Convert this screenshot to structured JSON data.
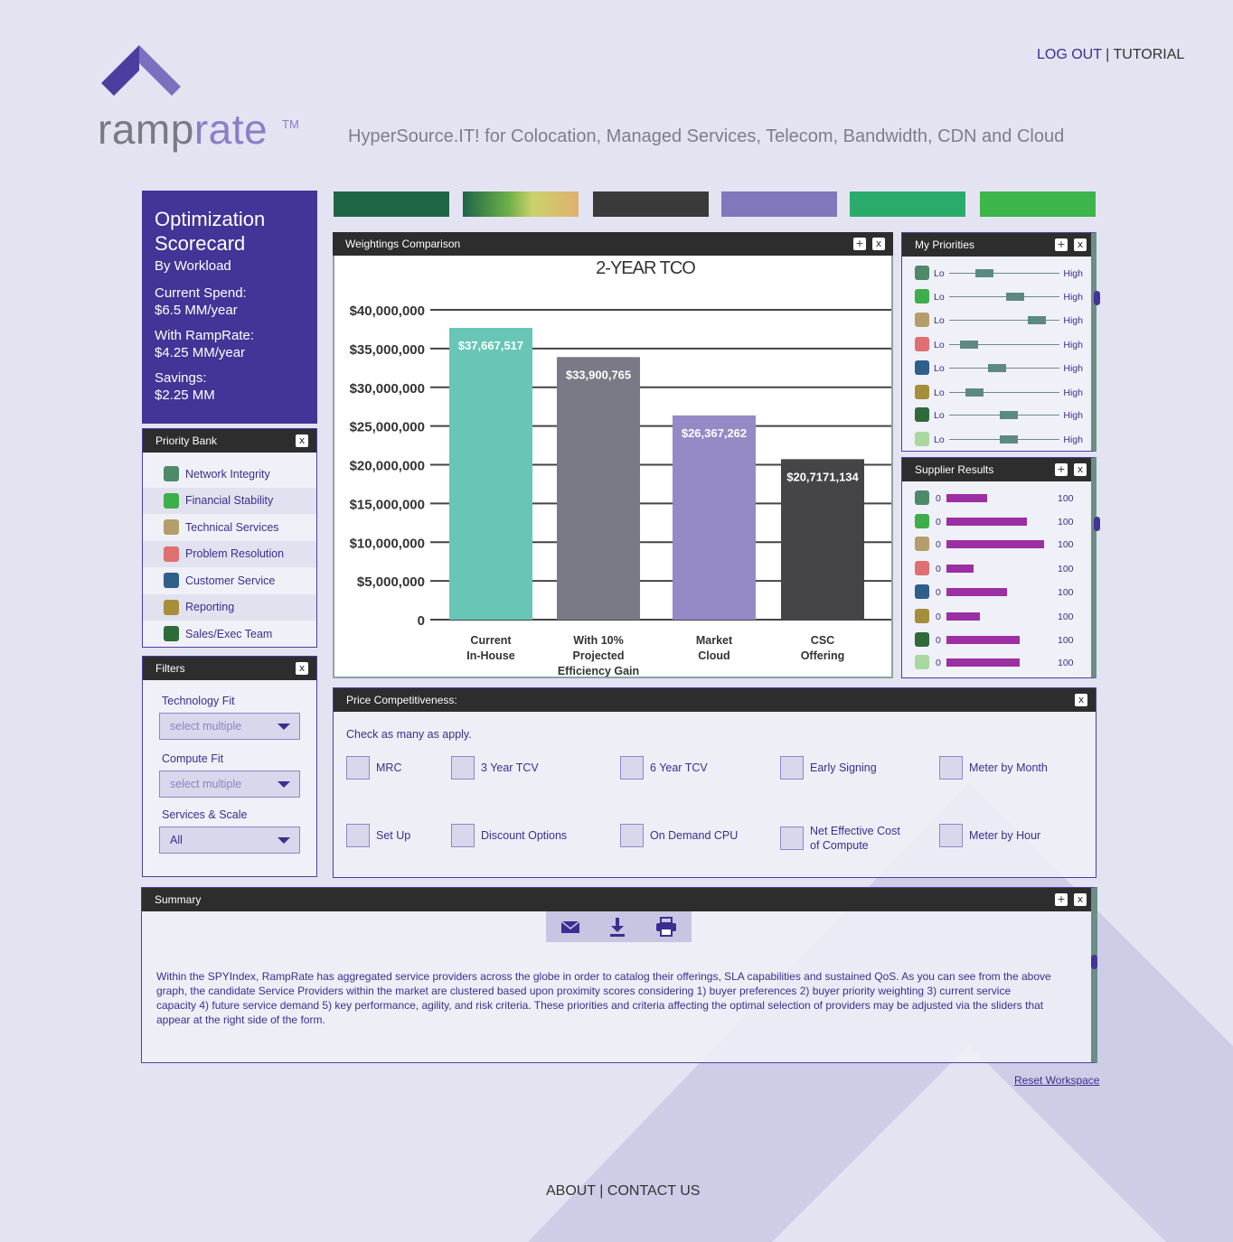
{
  "brand": {
    "word_a": "ramp",
    "word_b": "rate",
    "tm": "TM",
    "tagline": "HyperSource.IT! for Colocation, Managed Services, Telecom, Bandwidth, CDN and Cloud",
    "accent": "#433497"
  },
  "topnav": {
    "logout": "LOG OUT",
    "sep": "|",
    "tutorial": "TUTORIAL"
  },
  "scorecard": {
    "title_line1": "Optimization",
    "title_line2": "Scorecard",
    "subtitle": "By Workload",
    "current_label": "Current Spend:",
    "current_value": "$6.5 MM/year",
    "with_label": "With RampRate:",
    "with_value": "$4.25 MM/year",
    "savings_label": "Savings:",
    "savings_value": "$2.25 MM"
  },
  "priority_bank": {
    "title": "Priority Bank",
    "close": "x",
    "items": [
      {
        "label": "Network Integrity",
        "icon": "network-icon",
        "color": "#4e8a6a"
      },
      {
        "label": "Financial Stability",
        "icon": "financial-icon",
        "color": "#3cae4a"
      },
      {
        "label": "Technical Services",
        "icon": "wrench-icon",
        "color": "#b39d6a"
      },
      {
        "label": "Problem Resolution",
        "icon": "lifebuoy-icon",
        "color": "#e07070"
      },
      {
        "label": "Customer Service",
        "icon": "headset-icon",
        "color": "#2e5f8a"
      },
      {
        "label": "Reporting",
        "icon": "report-icon",
        "color": "#a58f3a"
      },
      {
        "label": "Sales/Exec Team",
        "icon": "person-icon",
        "color": "#2e6a3a"
      }
    ]
  },
  "filters": {
    "title": "Filters",
    "close": "x",
    "technology_label": "Technology Fit",
    "technology_value": "select multiple",
    "compute_label": "Compute Fit",
    "compute_value": "select multiple",
    "services_label": "Services & Scale",
    "services_value": "All"
  },
  "color_tabs": [
    "#1e6646",
    "#3a3a3a",
    "#8077bd",
    "#2aab6b",
    "#3cb54a"
  ],
  "weightings": {
    "title": "Weightings Comparison",
    "plus": "+",
    "close": "x"
  },
  "chart_data": {
    "type": "bar",
    "title": "2-YEAR TCO",
    "categories": [
      [
        "Current",
        "In-House"
      ],
      [
        "With 10%",
        "Projected",
        "Efficiency Gain"
      ],
      [
        "Market",
        "Cloud"
      ],
      [
        "CSC",
        "Offering"
      ]
    ],
    "values": [
      37667517,
      33900765,
      26367262,
      20717134
    ],
    "data_labels": [
      "$37,667,517",
      "$33,900,765",
      "$26,367,262",
      "$20,7171,134"
    ],
    "colors": [
      "#68c6b6",
      "#7a7a86",
      "#9689c6",
      "#454549"
    ],
    "ylim": [
      0,
      40000000
    ],
    "yticks": [
      0,
      5000000,
      10000000,
      15000000,
      20000000,
      25000000,
      30000000,
      35000000,
      40000000
    ],
    "ytick_labels": [
      "0",
      "$5,000,000",
      "$10,000,000",
      "$15,000,000",
      "$20,000,000",
      "$25,000,000",
      "$30,000,000",
      "$35,000,000",
      "$40,000,000"
    ],
    "grid": true
  },
  "my_priorities": {
    "title": "My Priorities",
    "plus": "+",
    "close": "x",
    "lo": "Lo",
    "hi": "High",
    "rows": [
      {
        "icon": "network-icon",
        "color": "#4e8a6a",
        "level": 0.28
      },
      {
        "icon": "financial-icon",
        "color": "#3cae4a",
        "level": 0.62
      },
      {
        "icon": "wrench-icon",
        "color": "#b39d6a",
        "level": 0.85
      },
      {
        "icon": "lifebuoy-icon",
        "color": "#e07070",
        "level": 0.12
      },
      {
        "icon": "headset-icon",
        "color": "#2e5f8a",
        "level": 0.42
      },
      {
        "icon": "report-icon",
        "color": "#a58f3a",
        "level": 0.18
      },
      {
        "icon": "person-icon",
        "color": "#2e6a3a",
        "level": 0.55
      },
      {
        "icon": "circle-icon",
        "color": "#a8d8a0",
        "level": 0.55
      }
    ]
  },
  "supplier_results": {
    "title": "Supplier Results",
    "plus": "+",
    "close": "x",
    "min": "0",
    "max": "100",
    "rows": [
      {
        "color": "#4e8a6a",
        "value": 42
      },
      {
        "color": "#3cae4a",
        "value": 82
      },
      {
        "color": "#b39d6a",
        "value": 100
      },
      {
        "color": "#e07070",
        "value": 28
      },
      {
        "color": "#2e5f8a",
        "value": 62
      },
      {
        "color": "#a58f3a",
        "value": 34
      },
      {
        "color": "#2e6a3a",
        "value": 75
      },
      {
        "color": "#a8d8a0",
        "value": 75
      }
    ]
  },
  "price": {
    "title": "Price Competitiveness:",
    "close": "x",
    "intro": "Check as many as apply.",
    "options": [
      "MRC",
      "3 Year TCV",
      "6 Year TCV",
      "Early Signing",
      "Meter by Month",
      "Set Up",
      "Discount Options",
      "On Demand CPU",
      "Net Effective Cost of Compute",
      "Meter by Hour"
    ]
  },
  "summary": {
    "title": "Summary",
    "plus": "+",
    "close": "x",
    "text": "Within the SPYIndex, RampRate has aggregated service providers across the globe in order to catalog their offerings, SLA capabilities and sustained QoS.  As you can see from the above graph, the candidate Service Providers within the market are clustered based upon proximity scores considering 1) buyer preferences 2) buyer priority weighting 3) current service capacity 4) future service demand 5) key performance, agility, and risk criteria.  These priorities and criteria affecting the optimal selection of providers may be adjusted via the sliders that appear at the right side of the form."
  },
  "reset": "Reset Workspace",
  "footer": {
    "about": "ABOUT",
    "sep": "|",
    "contact": "CONTACT US"
  }
}
